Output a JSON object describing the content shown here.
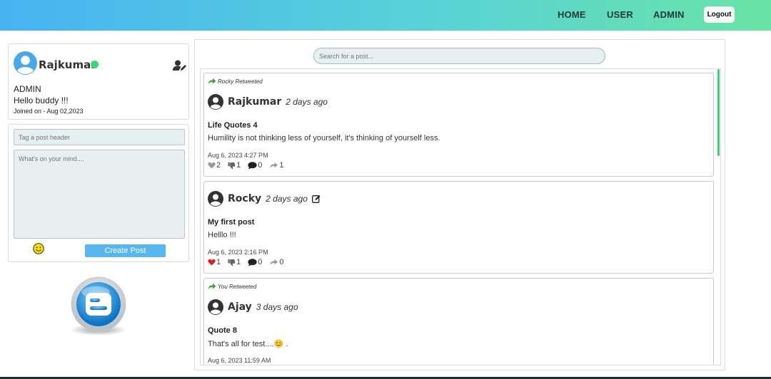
{
  "nav": {
    "home": "HOME",
    "user": "USER",
    "admin": "ADMIN",
    "logout": "Logout"
  },
  "colors": {
    "accent": "#56b6ef",
    "online": "#3ed27a",
    "heart_liked": "#e02020",
    "retweet_green": "#3ca03c"
  },
  "profile": {
    "name": "Rajkumar",
    "role": "ADMIN",
    "bio": "Hello buddy !!!",
    "joined": "Joined on - Aug 02,2023",
    "avatar_icon": "user-circle-icon",
    "edit_icon": "user-edit-icon"
  },
  "compose": {
    "header_placeholder": "Tag a post header",
    "body_placeholder": "What's on your mind....",
    "emoji_icon": "smiley-icon",
    "create_label": "Create Post"
  },
  "search": {
    "placeholder": "Search for a post..."
  },
  "posts": [
    {
      "retweet_note": "Rocky Retweeted",
      "author": "Rajkumar",
      "ago": "2 days ago",
      "title": "Life Quotes 4",
      "body": "Humility is not thinking less of yourself, it's thinking of yourself less.",
      "date": "Aug 6, 2023 4:27 PM",
      "likes": "2",
      "dislikes": "1",
      "comments": "0",
      "retweets": "1",
      "liked": false
    },
    {
      "retweet_note": "",
      "author": "Rocky",
      "ago": "2 days ago",
      "title": "My first post",
      "body": "Helllo !!!",
      "date": "Aug 6, 2023 2:16 PM",
      "likes": "1",
      "dislikes": "1",
      "comments": "0",
      "retweets": "0",
      "liked": true,
      "editable": true
    },
    {
      "retweet_note": "You Retweeted",
      "author": "Ajay",
      "ago": "3 days ago",
      "title": "Quote 8",
      "body": "That's all for test....😊 .",
      "date": "Aug 6, 2023 11:59 AM"
    }
  ]
}
